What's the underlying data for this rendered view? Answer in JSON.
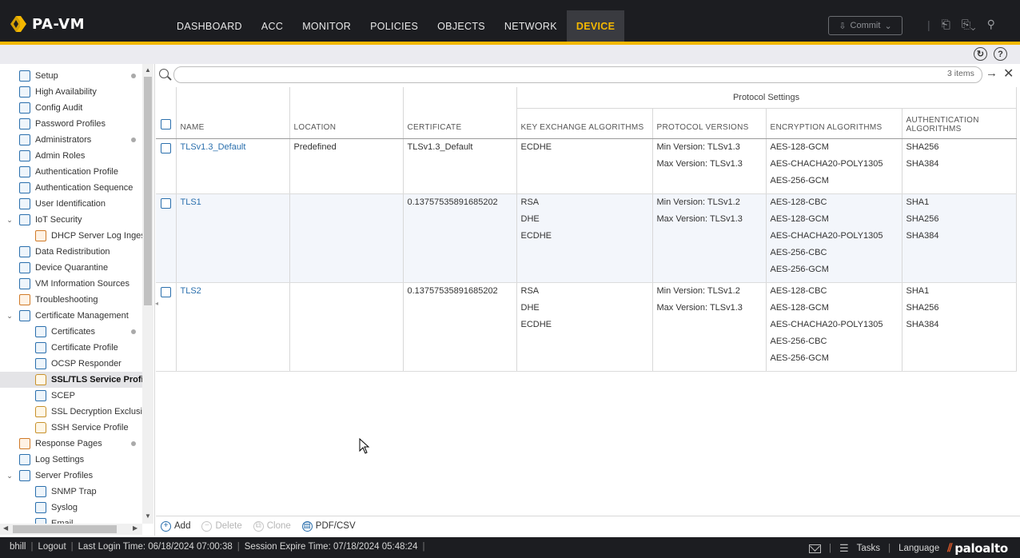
{
  "app": {
    "title": "PA-VM",
    "brand_color": "#f5b800",
    "nav_tabs": [
      {
        "label": "DASHBOARD",
        "active": false
      },
      {
        "label": "ACC",
        "active": false
      },
      {
        "label": "MONITOR",
        "active": false
      },
      {
        "label": "POLICIES",
        "active": false
      },
      {
        "label": "OBJECTS",
        "active": false
      },
      {
        "label": "NETWORK",
        "active": false
      },
      {
        "label": "DEVICE",
        "active": true
      }
    ],
    "commit_label": "Commit"
  },
  "sidebar": {
    "items": [
      {
        "label": "Setup",
        "icon": "setup-icon",
        "level": 0,
        "dot": true
      },
      {
        "label": "High Availability",
        "icon": "ha-icon",
        "level": 0
      },
      {
        "label": "Config Audit",
        "icon": "audit-icon",
        "level": 0
      },
      {
        "label": "Password Profiles",
        "icon": "key-icon",
        "level": 0
      },
      {
        "label": "Administrators",
        "icon": "admin-icon",
        "level": 0,
        "dot": true
      },
      {
        "label": "Admin Roles",
        "icon": "roles-icon",
        "level": 0
      },
      {
        "label": "Authentication Profile",
        "icon": "auth-profile-icon",
        "level": 0
      },
      {
        "label": "Authentication Sequence",
        "icon": "auth-sequence-icon",
        "level": 0
      },
      {
        "label": "User Identification",
        "icon": "user-id-icon",
        "level": 0
      },
      {
        "label": "IoT Security",
        "icon": "iot-icon",
        "level": 0,
        "expanded": true
      },
      {
        "label": "DHCP Server Log Inges",
        "icon": "dhcp-icon",
        "level": 1
      },
      {
        "label": "Data Redistribution",
        "icon": "redistribution-icon",
        "level": 0
      },
      {
        "label": "Device Quarantine",
        "icon": "quarantine-icon",
        "level": 0
      },
      {
        "label": "VM Information Sources",
        "icon": "vm-icon",
        "level": 0
      },
      {
        "label": "Troubleshooting",
        "icon": "wrench-icon",
        "level": 0
      },
      {
        "label": "Certificate Management",
        "icon": "certificate-icon",
        "level": 0,
        "expanded": true
      },
      {
        "label": "Certificates",
        "icon": "cert-icon",
        "level": 1,
        "dot": true
      },
      {
        "label": "Certificate Profile",
        "icon": "cert-profile-icon",
        "level": 1
      },
      {
        "label": "OCSP Responder",
        "icon": "ocsp-icon",
        "level": 1
      },
      {
        "label": "SSL/TLS Service Profile",
        "icon": "lock-icon",
        "level": 1,
        "selected": true
      },
      {
        "label": "SCEP",
        "icon": "scep-icon",
        "level": 1
      },
      {
        "label": "SSL Decryption Exclusio",
        "icon": "lock-icon",
        "level": 1
      },
      {
        "label": "SSH Service Profile",
        "icon": "lock-icon",
        "level": 1
      },
      {
        "label": "Response Pages",
        "icon": "response-pages-icon",
        "level": 0,
        "dot": true
      },
      {
        "label": "Log Settings",
        "icon": "log-icon",
        "level": 0
      },
      {
        "label": "Server Profiles",
        "icon": "server-icon",
        "level": 0,
        "expanded": true
      },
      {
        "label": "SNMP Trap",
        "icon": "snmp-icon",
        "level": 1
      },
      {
        "label": "Syslog",
        "icon": "syslog-icon",
        "level": 1
      },
      {
        "label": "Email",
        "icon": "email-icon",
        "level": 1
      }
    ]
  },
  "search": {
    "placeholder": "",
    "items_count": "3 items"
  },
  "table": {
    "group_header": "Protocol Settings",
    "columns": {
      "name": "NAME",
      "location": "LOCATION",
      "certificate": "CERTIFICATE",
      "key_exchange": "KEY EXCHANGE ALGORITHMS",
      "protocol_versions": "PROTOCOL VERSIONS",
      "encryption": "ENCRYPTION ALGORITHMS",
      "authentication": "AUTHENTICATION ALGORITHMS"
    },
    "rows": [
      {
        "name": "TLSv1.3_Default",
        "location": "Predefined",
        "certificate": "TLSv1.3_Default",
        "key_exchange": [
          "ECDHE"
        ],
        "protocol_versions": [
          "Min Version: TLSv1.3",
          "Max Version: TLSv1.3"
        ],
        "encryption": [
          "AES-128-GCM",
          "AES-CHACHA20-POLY1305",
          "AES-256-GCM"
        ],
        "authentication": [
          "SHA256",
          "SHA384"
        ]
      },
      {
        "name": "TLS1",
        "location": "",
        "certificate": "0.137575358916852​02",
        "key_exchange": [
          "RSA",
          "DHE",
          "ECDHE"
        ],
        "protocol_versions": [
          "Min Version: TLSv1.2",
          "Max Version: TLSv1.3"
        ],
        "encryption": [
          "AES-128-CBC",
          "AES-128-GCM",
          "AES-CHACHA20-POLY1305",
          "AES-256-CBC",
          "AES-256-GCM"
        ],
        "authentication": [
          "SHA1",
          "SHA256",
          "SHA384"
        ]
      },
      {
        "name": "TLS2",
        "location": "",
        "certificate": "0.13757535891685202",
        "key_exchange": [
          "RSA",
          "DHE",
          "ECDHE"
        ],
        "protocol_versions": [
          "Min Version: TLSv1.2",
          "Max Version: TLSv1.3"
        ],
        "encryption": [
          "AES-128-CBC",
          "AES-128-GCM",
          "AES-CHACHA20-POLY1305",
          "AES-256-CBC",
          "AES-256-GCM"
        ],
        "authentication": [
          "SHA1",
          "SHA256",
          "SHA384"
        ]
      }
    ]
  },
  "actions": {
    "add": "Add",
    "delete": "Delete",
    "clone": "Clone",
    "pdf_csv": "PDF/CSV"
  },
  "footer": {
    "user": "bhill",
    "logout": "Logout",
    "last_login": "Last Login Time: 06/18/2024 07:00:38",
    "session_expire": "Session Expire Time: 07/18/2024 05:48:24",
    "tasks": "Tasks",
    "language": "Language",
    "brand": "paloalto"
  }
}
